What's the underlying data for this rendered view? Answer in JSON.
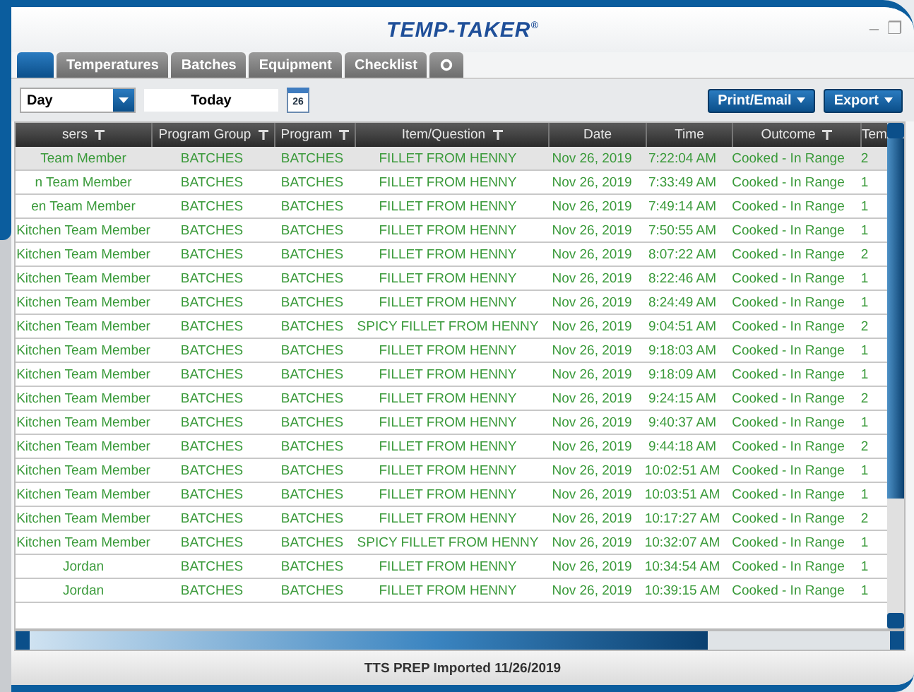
{
  "window": {
    "title": "TEMP-TAKER",
    "title_mark": "®",
    "controls": [
      "–",
      "❐"
    ]
  },
  "tabs": [
    {
      "kind": "stub",
      "selected": true
    },
    {
      "kind": "text",
      "label": "Temperatures",
      "selected": false
    },
    {
      "kind": "text",
      "label": "Batches",
      "selected": false
    },
    {
      "kind": "text",
      "label": "Equipment",
      "selected": false
    },
    {
      "kind": "text",
      "label": "Checklist",
      "selected": false
    },
    {
      "kind": "gear",
      "selected": false
    }
  ],
  "toolbar": {
    "period": "Day",
    "date": "Today",
    "calendar_day": "26",
    "buttons": [
      "Print/Email",
      "Export"
    ]
  },
  "table": {
    "columns": [
      {
        "label": "sers",
        "filter": true
      },
      {
        "label": "Program Group",
        "filter": true
      },
      {
        "label": "Program",
        "filter": true
      },
      {
        "label": "Item/Question",
        "filter": true
      },
      {
        "label": "Date",
        "filter": false
      },
      {
        "label": "Time",
        "filter": false
      },
      {
        "label": "Outcome",
        "filter": true
      },
      {
        "label": "Tem",
        "filter": false
      }
    ],
    "rows": [
      {
        "selected": true,
        "cells": [
          "Team Member",
          "BATCHES",
          "BATCHES",
          "FILLET FROM HENNY",
          "Nov 26, 2019",
          "7:22:04 AM",
          "Cooked - In Range",
          "2"
        ]
      },
      {
        "selected": false,
        "cells": [
          "n Team Member",
          "BATCHES",
          "BATCHES",
          "FILLET FROM HENNY",
          "Nov 26, 2019",
          "7:33:49 AM",
          "Cooked - In Range",
          "1"
        ]
      },
      {
        "selected": false,
        "cells": [
          "en Team Member",
          "BATCHES",
          "BATCHES",
          "FILLET FROM HENNY",
          "Nov 26, 2019",
          "7:49:14 AM",
          "Cooked - In Range",
          "1"
        ]
      },
      {
        "selected": false,
        "cells": [
          "Kitchen Team Member",
          "BATCHES",
          "BATCHES",
          "FILLET FROM HENNY",
          "Nov 26, 2019",
          "7:50:55 AM",
          "Cooked - In Range",
          "1"
        ]
      },
      {
        "selected": false,
        "cells": [
          "Kitchen Team Member",
          "BATCHES",
          "BATCHES",
          "FILLET FROM HENNY",
          "Nov 26, 2019",
          "8:07:22 AM",
          "Cooked - In Range",
          "2"
        ]
      },
      {
        "selected": false,
        "cells": [
          "Kitchen Team Member",
          "BATCHES",
          "BATCHES",
          "FILLET FROM HENNY",
          "Nov 26, 2019",
          "8:22:46 AM",
          "Cooked - In Range",
          "1"
        ]
      },
      {
        "selected": false,
        "cells": [
          "Kitchen Team Member",
          "BATCHES",
          "BATCHES",
          "FILLET FROM HENNY",
          "Nov 26, 2019",
          "8:24:49 AM",
          "Cooked - In Range",
          "1"
        ]
      },
      {
        "selected": false,
        "cells": [
          "Kitchen Team Member",
          "BATCHES",
          "BATCHES",
          "SPICY FILLET FROM HENNY",
          "Nov 26, 2019",
          "9:04:51 AM",
          "Cooked - In Range",
          "2"
        ]
      },
      {
        "selected": false,
        "cells": [
          "Kitchen Team Member",
          "BATCHES",
          "BATCHES",
          "FILLET FROM HENNY",
          "Nov 26, 2019",
          "9:18:03 AM",
          "Cooked - In Range",
          "1"
        ]
      },
      {
        "selected": false,
        "cells": [
          "Kitchen Team Member",
          "BATCHES",
          "BATCHES",
          "FILLET FROM HENNY",
          "Nov 26, 2019",
          "9:18:09 AM",
          "Cooked - In Range",
          "1"
        ]
      },
      {
        "selected": false,
        "cells": [
          "Kitchen Team Member",
          "BATCHES",
          "BATCHES",
          "FILLET FROM HENNY",
          "Nov 26, 2019",
          "9:24:15 AM",
          "Cooked - In Range",
          "2"
        ]
      },
      {
        "selected": false,
        "cells": [
          "Kitchen Team Member",
          "BATCHES",
          "BATCHES",
          "FILLET FROM HENNY",
          "Nov 26, 2019",
          "9:40:37 AM",
          "Cooked - In Range",
          "1"
        ]
      },
      {
        "selected": false,
        "cells": [
          "Kitchen Team Member",
          "BATCHES",
          "BATCHES",
          "FILLET FROM HENNY",
          "Nov 26, 2019",
          "9:44:18 AM",
          "Cooked - In Range",
          "2"
        ]
      },
      {
        "selected": false,
        "cells": [
          "Kitchen Team Member",
          "BATCHES",
          "BATCHES",
          "FILLET FROM HENNY",
          "Nov 26, 2019",
          "10:02:51 AM",
          "Cooked - In Range",
          "1"
        ]
      },
      {
        "selected": false,
        "cells": [
          "Kitchen Team Member",
          "BATCHES",
          "BATCHES",
          "FILLET FROM HENNY",
          "Nov 26, 2019",
          "10:03:51 AM",
          "Cooked - In Range",
          "1"
        ]
      },
      {
        "selected": false,
        "cells": [
          "Kitchen Team Member",
          "BATCHES",
          "BATCHES",
          "FILLET FROM HENNY",
          "Nov 26, 2019",
          "10:17:27 AM",
          "Cooked - In Range",
          "2"
        ]
      },
      {
        "selected": false,
        "cells": [
          "Kitchen Team Member",
          "BATCHES",
          "BATCHES",
          "SPICY FILLET FROM HENNY",
          "Nov 26, 2019",
          "10:32:07 AM",
          "Cooked - In Range",
          "1"
        ]
      },
      {
        "selected": false,
        "cells": [
          "Jordan",
          "BATCHES",
          "BATCHES",
          "FILLET FROM HENNY",
          "Nov 26, 2019",
          "10:34:54 AM",
          "Cooked - In Range",
          "1"
        ]
      },
      {
        "selected": false,
        "cells": [
          "Jordan",
          "BATCHES",
          "BATCHES",
          "FILLET FROM HENNY",
          "Nov 26, 2019",
          "10:39:15 AM",
          "Cooked - In Range",
          "1"
        ]
      }
    ]
  },
  "status_bar": "TTS PREP Imported 11/26/2019"
}
